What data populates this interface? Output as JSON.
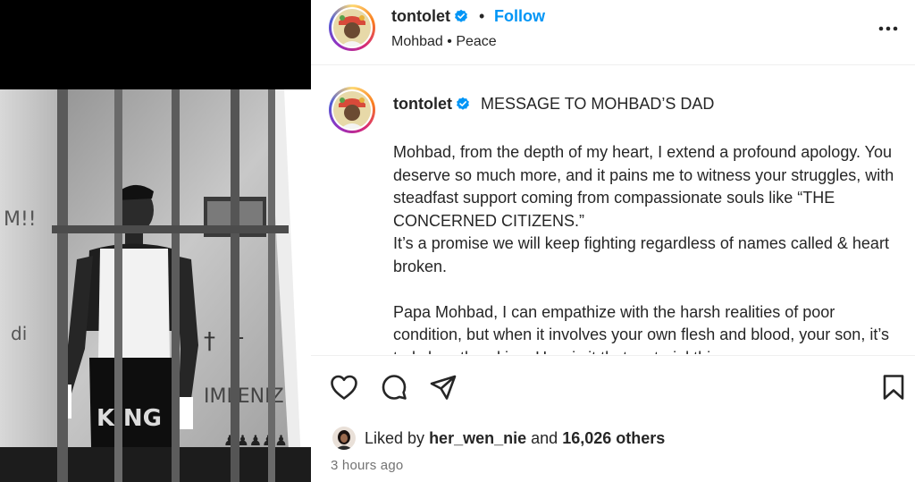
{
  "header": {
    "username": "tontolet",
    "separator": "•",
    "follow_label": "Follow",
    "subtitle": "Mohbad • Peace",
    "more_icon": "more-horizontal-icon"
  },
  "caption": {
    "username": "tontolet",
    "title": "MESSAGE TO MOHBAD’S DAD",
    "paragraph_1": "Mohbad, from the depth of my heart, I extend a profound apology. You deserve so much more, and it pains me to witness your struggles, with steadfast support coming from compassionate souls like “THE CONCERNED CITIZENS.”",
    "paragraph_1b": "It’s a promise we will keep fighting regardless of names called & heart broken.",
    "paragraph_2": "Papa Mohbad, I can empathize with the harsh realities of poor condition, but when it involves your own flesh and blood, your son, it’s truly heartbreaking. How is it that material things or"
  },
  "actions": {
    "like_icon": "heart-icon",
    "comment_icon": "comment-icon",
    "share_icon": "send-icon",
    "save_icon": "bookmark-icon"
  },
  "likes": {
    "prefix": "Liked by",
    "user": "her_wen_nie",
    "middle": "and",
    "count": "16,026 others"
  },
  "timestamp": "3 hours ago",
  "colors": {
    "accent": "#0095f6",
    "verified": "#0095f6",
    "text": "#262626",
    "muted": "#737373"
  }
}
